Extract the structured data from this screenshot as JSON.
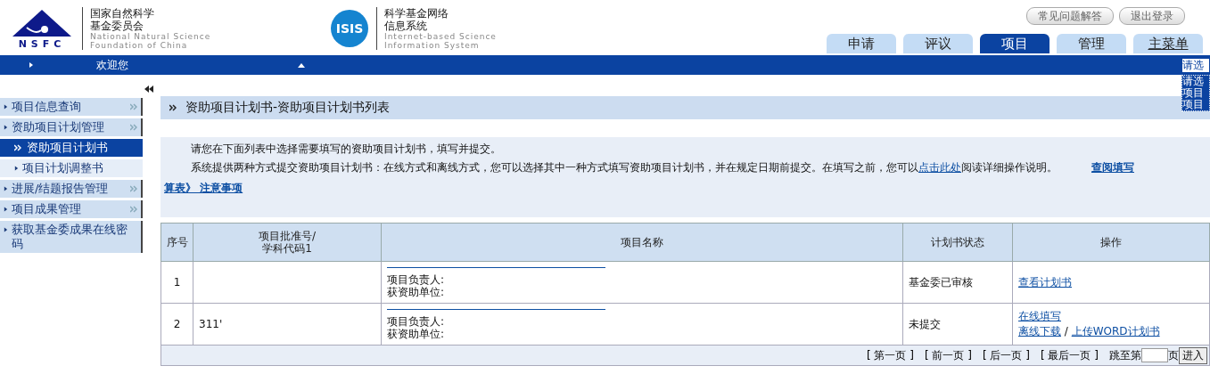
{
  "header": {
    "org_name_cn": [
      "国家自然科学",
      "基金委员会"
    ],
    "org_name_en": [
      "National Natural Science",
      "Foundation of China"
    ],
    "logo_text": "NSFC",
    "system_logo_text": "ISIS",
    "system_name_cn": [
      "科学基金网络",
      "信息系统"
    ],
    "system_name_en": [
      "Internet-based Science",
      "Information System"
    ],
    "top_links": [
      "常见问题解答",
      "退出登录"
    ],
    "tabs": [
      {
        "label": "申请",
        "selected": false
      },
      {
        "label": "评议",
        "selected": false
      },
      {
        "label": "项目",
        "selected": true
      },
      {
        "label": "管理",
        "selected": false
      },
      {
        "label": "主菜单",
        "selected": false
      }
    ]
  },
  "nav_bar": {
    "welcome": "欢迎您",
    "menu_select": {
      "value": "请选",
      "options": [
        "请选",
        "项目",
        "项目"
      ]
    }
  },
  "sidebar": {
    "items": [
      {
        "label": "项目信息查询",
        "kind": "group",
        "expandable": true,
        "selected": false
      },
      {
        "label": "资助项目计划管理",
        "kind": "group",
        "expandable": true,
        "selected": false
      },
      {
        "label": "资助项目计划书",
        "kind": "sub",
        "expandable": false,
        "selected": true
      },
      {
        "label": "项目计划调整书",
        "kind": "sub",
        "expandable": false,
        "selected": false
      },
      {
        "label": "进展/结题报告管理",
        "kind": "group",
        "expandable": true,
        "selected": false
      },
      {
        "label": "项目成果管理",
        "kind": "group",
        "expandable": true,
        "selected": false
      },
      {
        "label": "获取基金委成果在线密码",
        "kind": "group",
        "expandable": false,
        "selected": false
      }
    ]
  },
  "main": {
    "title": "资助项目计划书-资助项目计划书列表",
    "instructions": {
      "line_1": "请您在下面列表中选择需要填写的资助项目计划书，填写并提交。",
      "line_2_before": "系统提供两种方式提交资助项目计划书：在线方式和离线方式，您可以选择其中一种方式填写资助项目计划书，并在规定日期前提交。在填写之前，您可以",
      "line_2_link": "点击此处",
      "line_2_after": "阅读详细操作说明。",
      "guide_link_start": "查阅填写",
      "guide_link_end": "算表》 注意事项"
    },
    "table": {
      "columns": [
        "序号",
        "项目批准号/\n学科代码1",
        "项目名称",
        "计划书状态",
        "操作"
      ],
      "rows": [
        {
          "index": "1",
          "approval_no": "",
          "leader_label": "项目负责人:",
          "unit_label": "获资助单位:",
          "status": "基金委已审核",
          "actions": [
            [
              "查看计划书"
            ]
          ]
        },
        {
          "index": "2",
          "approval_no": "311'",
          "leader_label": "项目负责人:",
          "unit_label": "获资助单位:",
          "status": "未提交",
          "actions": [
            [
              "在线填写"
            ],
            [
              "离线下载",
              "上传WORD计划书"
            ]
          ]
        }
      ],
      "action_separator": "/"
    },
    "pagination": {
      "links": [
        "[ 第一页 ]",
        "[ 前一页 ]",
        "[ 后一页 ]",
        "[ 最后一页 ]"
      ],
      "jump_label": "跳至第",
      "page_suffix": "页",
      "go_button": "进入"
    }
  }
}
